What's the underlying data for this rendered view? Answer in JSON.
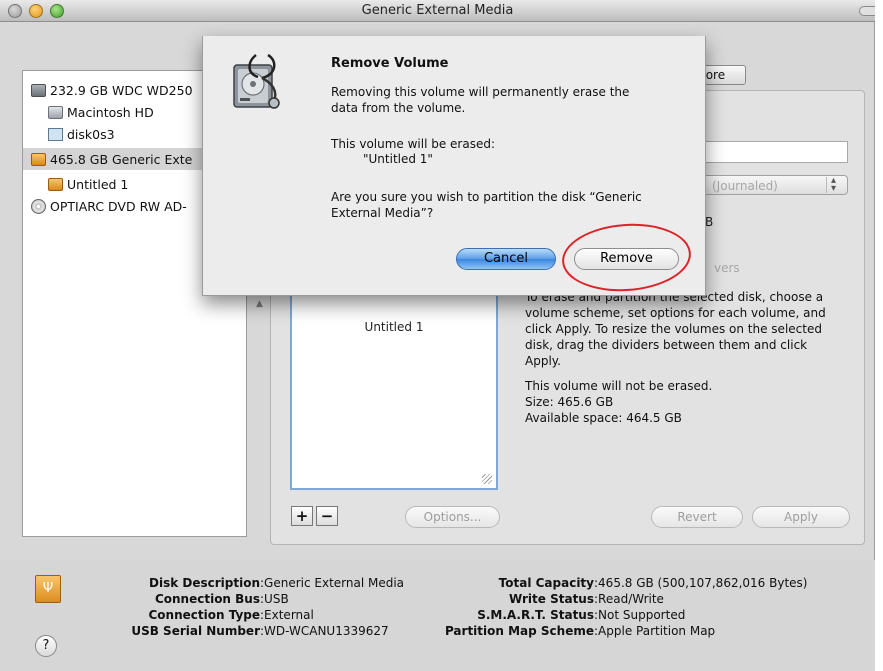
{
  "window": {
    "title": "Generic External Media"
  },
  "sidebar": {
    "items": [
      {
        "label": "232.9 GB WDC WD250",
        "icon": "hard-drive-icon"
      },
      {
        "label": "Macintosh HD",
        "icon": "volume-icon"
      },
      {
        "label": "disk0s3",
        "icon": "disk-image-icon"
      },
      {
        "label": "465.8 GB Generic Exte",
        "icon": "usb-drive-icon"
      },
      {
        "label": "Untitled 1",
        "icon": "usb-volume-icon"
      },
      {
        "label": "OPTIARC DVD RW AD-",
        "icon": "dvd-drive-icon"
      }
    ]
  },
  "partition": {
    "tab_restore": "tore",
    "format_value": "(Journaled)",
    "size_unit": "B",
    "partial_text": "vers",
    "volume_label": "Untitled 1",
    "info_lines": [
      "To erase and partition the selected disk, choose a",
      "volume scheme, set options for each volume, and",
      "click Apply. To resize the volumes on the selected",
      "disk, drag the dividers between them and click",
      "Apply."
    ],
    "erase_lines": [
      "This volume will not be erased.",
      "Size: 465.6 GB",
      "Available space: 464.5 GB"
    ],
    "plus_label": "+",
    "minus_label": "−",
    "options_label": "Options...",
    "revert_label": "Revert",
    "apply_label": "Apply"
  },
  "dialog": {
    "title": "Remove Volume",
    "message_lines": [
      "Removing this volume will permanently erase the",
      "data from the volume."
    ],
    "erased_label": "This volume will be erased:",
    "erased_volume": "\"Untitled 1\"",
    "confirm_lines": [
      "Are you sure you wish to partition the disk “Generic",
      "External Media”?"
    ],
    "cancel_label": "Cancel",
    "remove_label": "Remove"
  },
  "footer": {
    "left": [
      {
        "key": "Disk Description",
        "value": "Generic External Media"
      },
      {
        "key": "Connection Bus",
        "value": "USB"
      },
      {
        "key": "Connection Type",
        "value": "External"
      },
      {
        "key": "USB Serial Number",
        "value": "WD-WCANU1339627"
      }
    ],
    "right": [
      {
        "key": "Total Capacity",
        "value": "465.8 GB (500,107,862,016 Bytes)"
      },
      {
        "key": "Write Status",
        "value": "Read/Write"
      },
      {
        "key": "S.M.A.R.T. Status",
        "value": "Not Supported"
      },
      {
        "key": "Partition Map Scheme",
        "value": "Apple Partition Map"
      }
    ],
    "help_label": "?"
  },
  "colors": {
    "highlight_ring": "#d9252a",
    "default_button": "#3a86e0",
    "selection": "#d4d4d4"
  }
}
